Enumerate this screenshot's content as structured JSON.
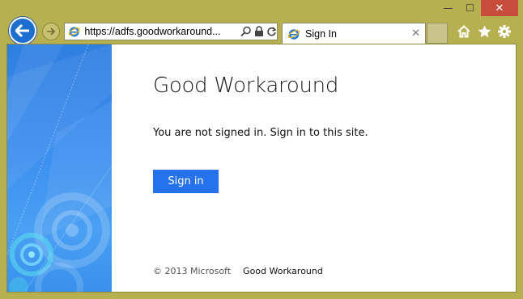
{
  "window": {
    "caption": {
      "minimize": "—",
      "maximize": "☐",
      "close": "✕"
    }
  },
  "nav": {
    "back_icon": "back-arrow-icon",
    "forward_icon": "forward-arrow-icon",
    "address": "https://adfs.goodworkaround...",
    "address_icons": [
      "search-icon",
      "lock-icon",
      "refresh-icon"
    ]
  },
  "tab": {
    "title": "Sign In",
    "close": "✕"
  },
  "toolbar": {
    "icons": [
      "home-icon",
      "favorites-star-icon",
      "settings-gear-icon"
    ]
  },
  "page": {
    "org_title": "Good Workaround",
    "message": "You are not signed in. Sign in to this site.",
    "sign_in_label": "Sign in",
    "footer": {
      "copyright": "© 2013 Microsoft",
      "link": "Good Workaround"
    }
  },
  "colors": {
    "frame": "#b7b050",
    "accent": "#2672ec",
    "back_button": "#1c6fd1",
    "close_button": "#c74c3c"
  }
}
